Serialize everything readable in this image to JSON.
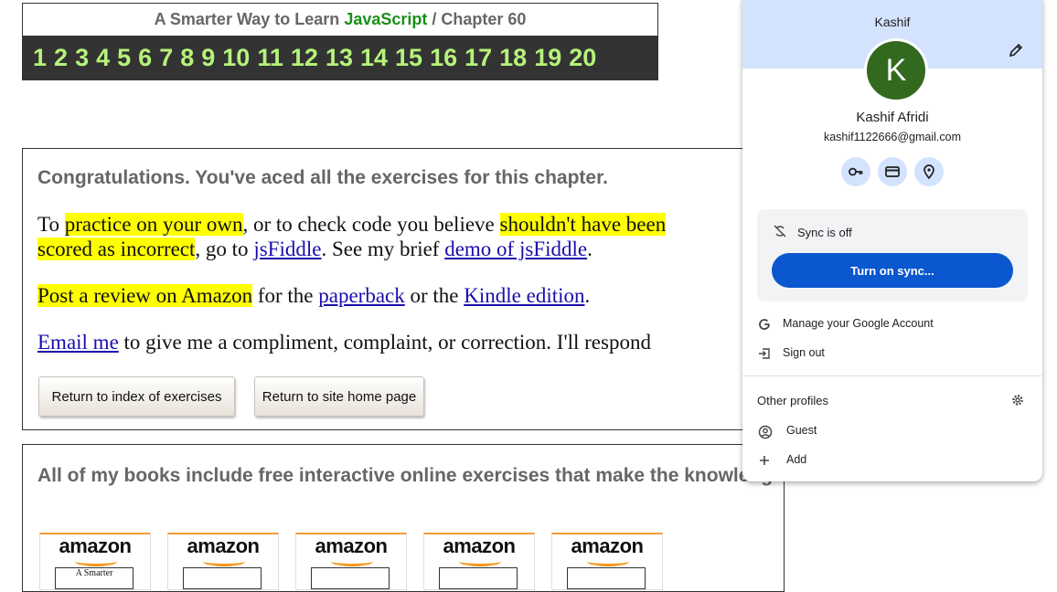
{
  "header": {
    "title_prefix": "A Smarter Way to Learn ",
    "title_js": "JavaScript",
    "title_suffix": "  /  Chapter 60",
    "chapters": [
      "1",
      "2",
      "3",
      "4",
      "5",
      "6",
      "7",
      "8",
      "9",
      "10",
      "11",
      "12",
      "13",
      "14",
      "15",
      "16",
      "17",
      "18",
      "19",
      "20"
    ]
  },
  "congrats": {
    "heading": "Congratulations. You've aced all the exercises for this chapter.",
    "p1_a": "To ",
    "p1_hl1": "practice on your own",
    "p1_b": ", or to check code you believe ",
    "p1_hl2": "shouldn't have been",
    "p1_hl3": "scored as incorrect",
    "p1_c": ", go to ",
    "p1_link1": "jsFiddle",
    "p1_d": ". See my brief ",
    "p1_link2": "demo of jsFiddle",
    "p1_e": ".",
    "p2_hl": "Post a review on Amazon",
    "p2_a": " for the ",
    "p2_link1": "paperback",
    "p2_b": " or the ",
    "p2_link2": "Kindle edition",
    "p2_c": ".",
    "p3_link": "Email me",
    "p3_a": " to give me a compliment, complaint, or correction. I'll respond",
    "btn_index": "Return to index of exercises",
    "btn_home": "Return to site home page"
  },
  "books": {
    "text": "All of my books include free interactive online exercises that make the knowledge stick.",
    "amazon_label": "amazon",
    "cover_label": "A Smarter"
  },
  "profile": {
    "top_name": "Kashif",
    "avatar_letter": "K",
    "full_name": "Kashif Afridi",
    "email": "kashif1122666@gmail.com",
    "sync_status": "Sync is off",
    "sync_button": "Turn on sync...",
    "manage": "Manage your Google Account",
    "sign_out": "Sign out",
    "other_profiles": "Other profiles",
    "guest": "Guest",
    "add": "Add",
    "avatar_color": "#33691e",
    "accent": "#0b57d0",
    "icons": [
      "key-icon",
      "card-icon",
      "location-icon"
    ]
  }
}
